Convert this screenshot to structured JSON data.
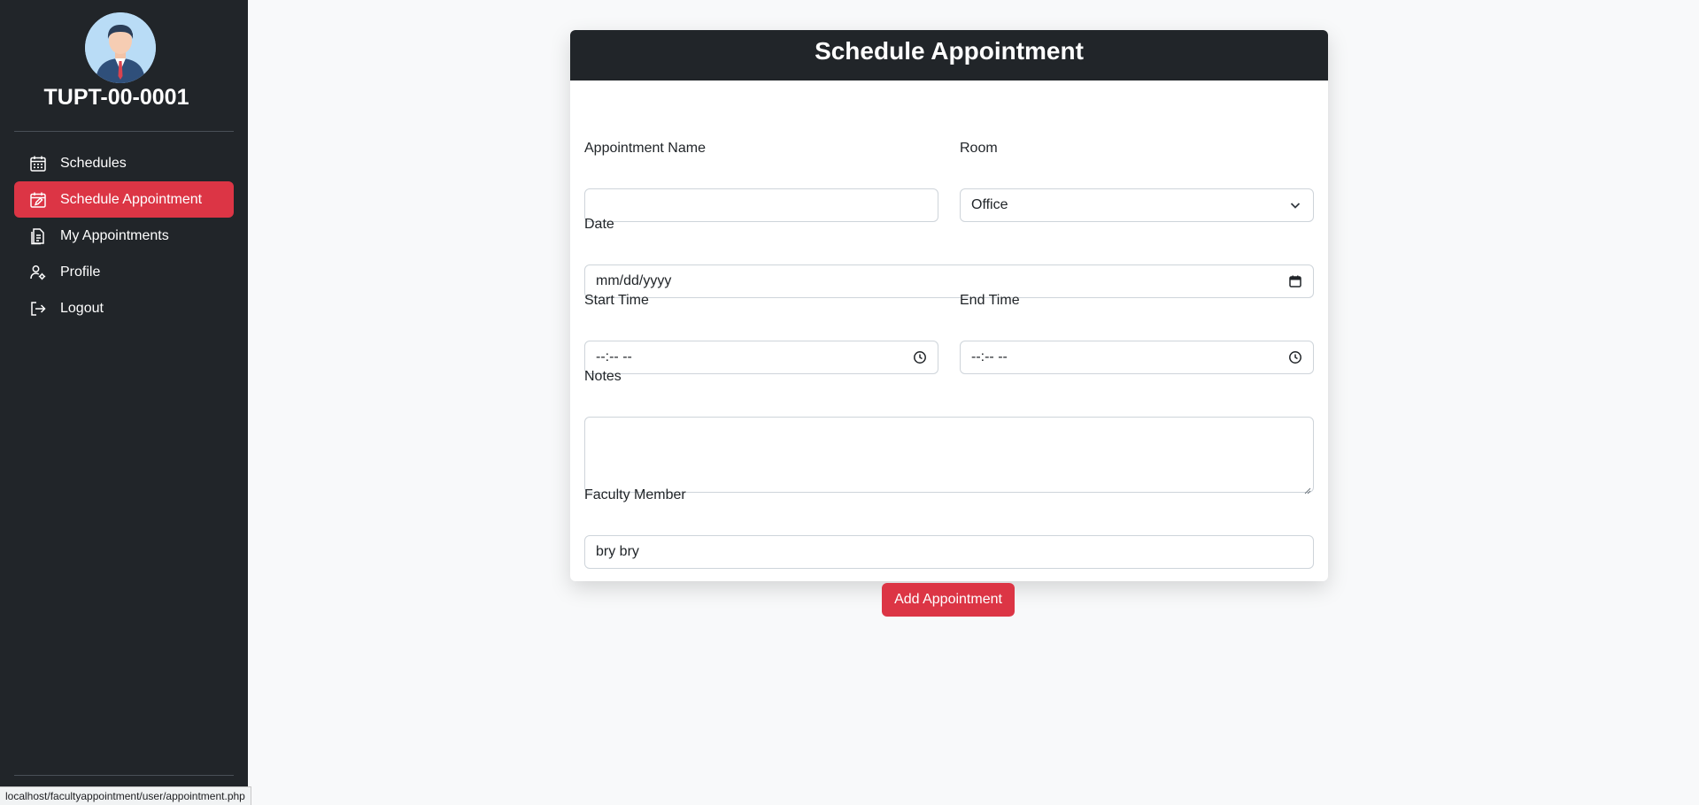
{
  "sidebar": {
    "user_id": "TUPT-00-0001",
    "items": [
      {
        "label": "Schedules",
        "icon": "calendar-icon",
        "active": false
      },
      {
        "label": "Schedule Appointment",
        "icon": "calendar-edit-icon",
        "active": true
      },
      {
        "label": "My Appointments",
        "icon": "document-icon",
        "active": false
      },
      {
        "label": "Profile",
        "icon": "user-gear-icon",
        "active": false
      },
      {
        "label": "Logout",
        "icon": "logout-icon",
        "active": false
      }
    ]
  },
  "status_bar": {
    "url": "localhost/facultyappointment/user/appointment.php"
  },
  "form": {
    "title": "Schedule Appointment",
    "appointment_name": {
      "label": "Appointment Name",
      "value": ""
    },
    "room": {
      "label": "Room",
      "value": "Office"
    },
    "date": {
      "label": "Date",
      "value": "mm/dd/yyyy"
    },
    "start_time": {
      "label": "Start Time",
      "value": "--:-- --"
    },
    "end_time": {
      "label": "End Time",
      "value": "--:-- --"
    },
    "notes": {
      "label": "Notes",
      "value": ""
    },
    "faculty_member": {
      "label": "Faculty Member",
      "value": "bry bry"
    },
    "submit_label": "Add Appointment"
  },
  "colors": {
    "sidebar_bg": "#212529",
    "accent": "#dc3545",
    "page_bg": "#f8f9fa"
  }
}
